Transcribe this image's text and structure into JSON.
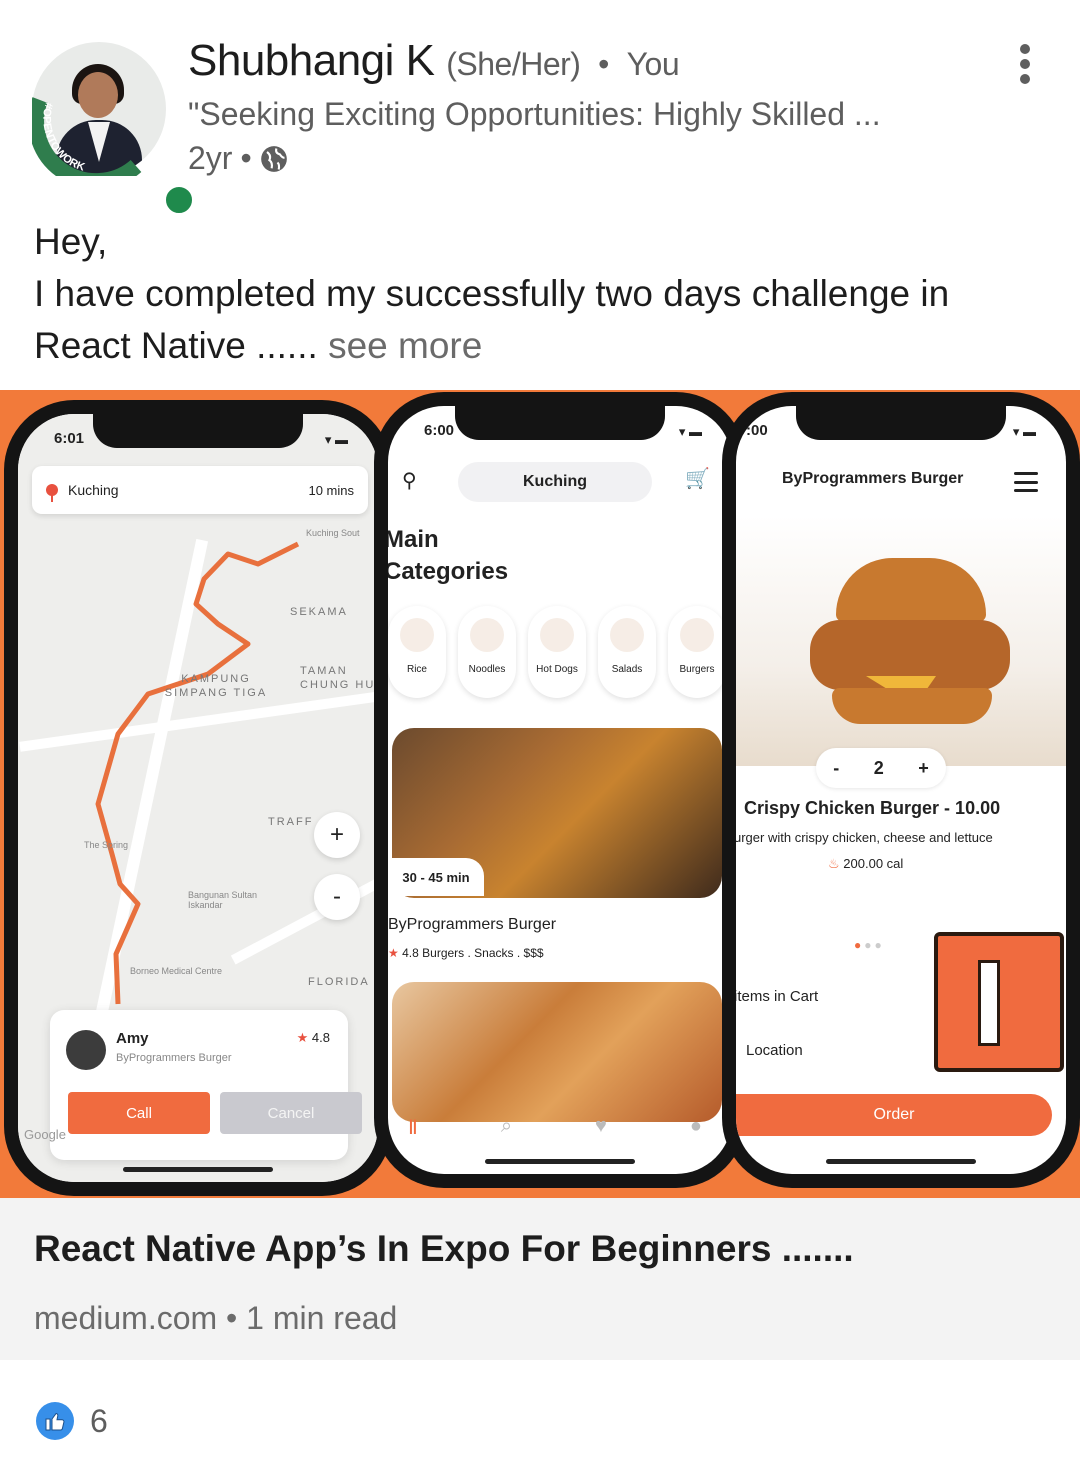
{
  "author": {
    "name": "Shubhangi K",
    "pronouns": "(She/Her)",
    "separator": "•",
    "relation": "You",
    "headline": "\"Seeking Exciting Opportunities: Highly Skilled ...",
    "badge_text": "#OPENTOWORK",
    "badge_color": "#2f7d4d",
    "online_color": "#1f8a4c"
  },
  "post": {
    "age": "2yr",
    "meta_separator": "•",
    "visibility_icon": "globe-icon",
    "text_line1": "Hey,",
    "text_line2": "I have completed my successfully two days challenge in",
    "text_line3": "React Native ......",
    "see_more": "see more"
  },
  "image": {
    "background_color": "#f27a3a",
    "phone_map": {
      "time": "6:01",
      "location": "Kuching",
      "eta": "10 mins",
      "area_labels": [
        "SEKAMA",
        "KAMPUNG SIMPANG TIGA",
        "TAMAN CHUNG HU",
        "TRAFF",
        "FLORIDA"
      ],
      "place_labels": [
        "Kuching Sout",
        "Bangunan Sultan Iskandar",
        "Borneo Medical Centre",
        "The Spring"
      ],
      "zoom_in": "+",
      "zoom_out": "-",
      "driver_name": "Amy",
      "driver_sub": "ByProgrammers Burger",
      "driver_rating": "4.8",
      "call_label": "Call",
      "cancel_label": "Cancel",
      "map_credit": "Google"
    },
    "phone_categories": {
      "time": "6:00",
      "location": "Kuching",
      "title_line1": "Main",
      "title_line2": "Categories",
      "categories": [
        "Rice",
        "Noodles",
        "Hot Dogs",
        "Salads",
        "Burgers"
      ],
      "time_pill": "30 - 45 min",
      "restaurant": "ByProgrammers Burger",
      "rating": "4.8",
      "tags": "Burgers . Snacks . $$$"
    },
    "phone_detail": {
      "time": ":00",
      "title": "ByProgrammers Burger",
      "qty_minus": "-",
      "qty_value": "2",
      "qty_plus": "+",
      "item_name": "Crispy Chicken Burger - 10.00",
      "item_desc": "urger with crispy chicken, cheese and lettuce",
      "calories": "200.00 cal",
      "cart_label": "items in Cart",
      "location_label": "Location",
      "order_label": "Order",
      "accent": "#f06b3f"
    }
  },
  "link": {
    "title": "React Native App’s In Expo For Beginners .......",
    "source": "medium.com",
    "separator": "•",
    "read_time": "1 min read"
  },
  "reactions": {
    "icon": "like-icon",
    "count": "6",
    "icon_color": "#378fe9"
  }
}
